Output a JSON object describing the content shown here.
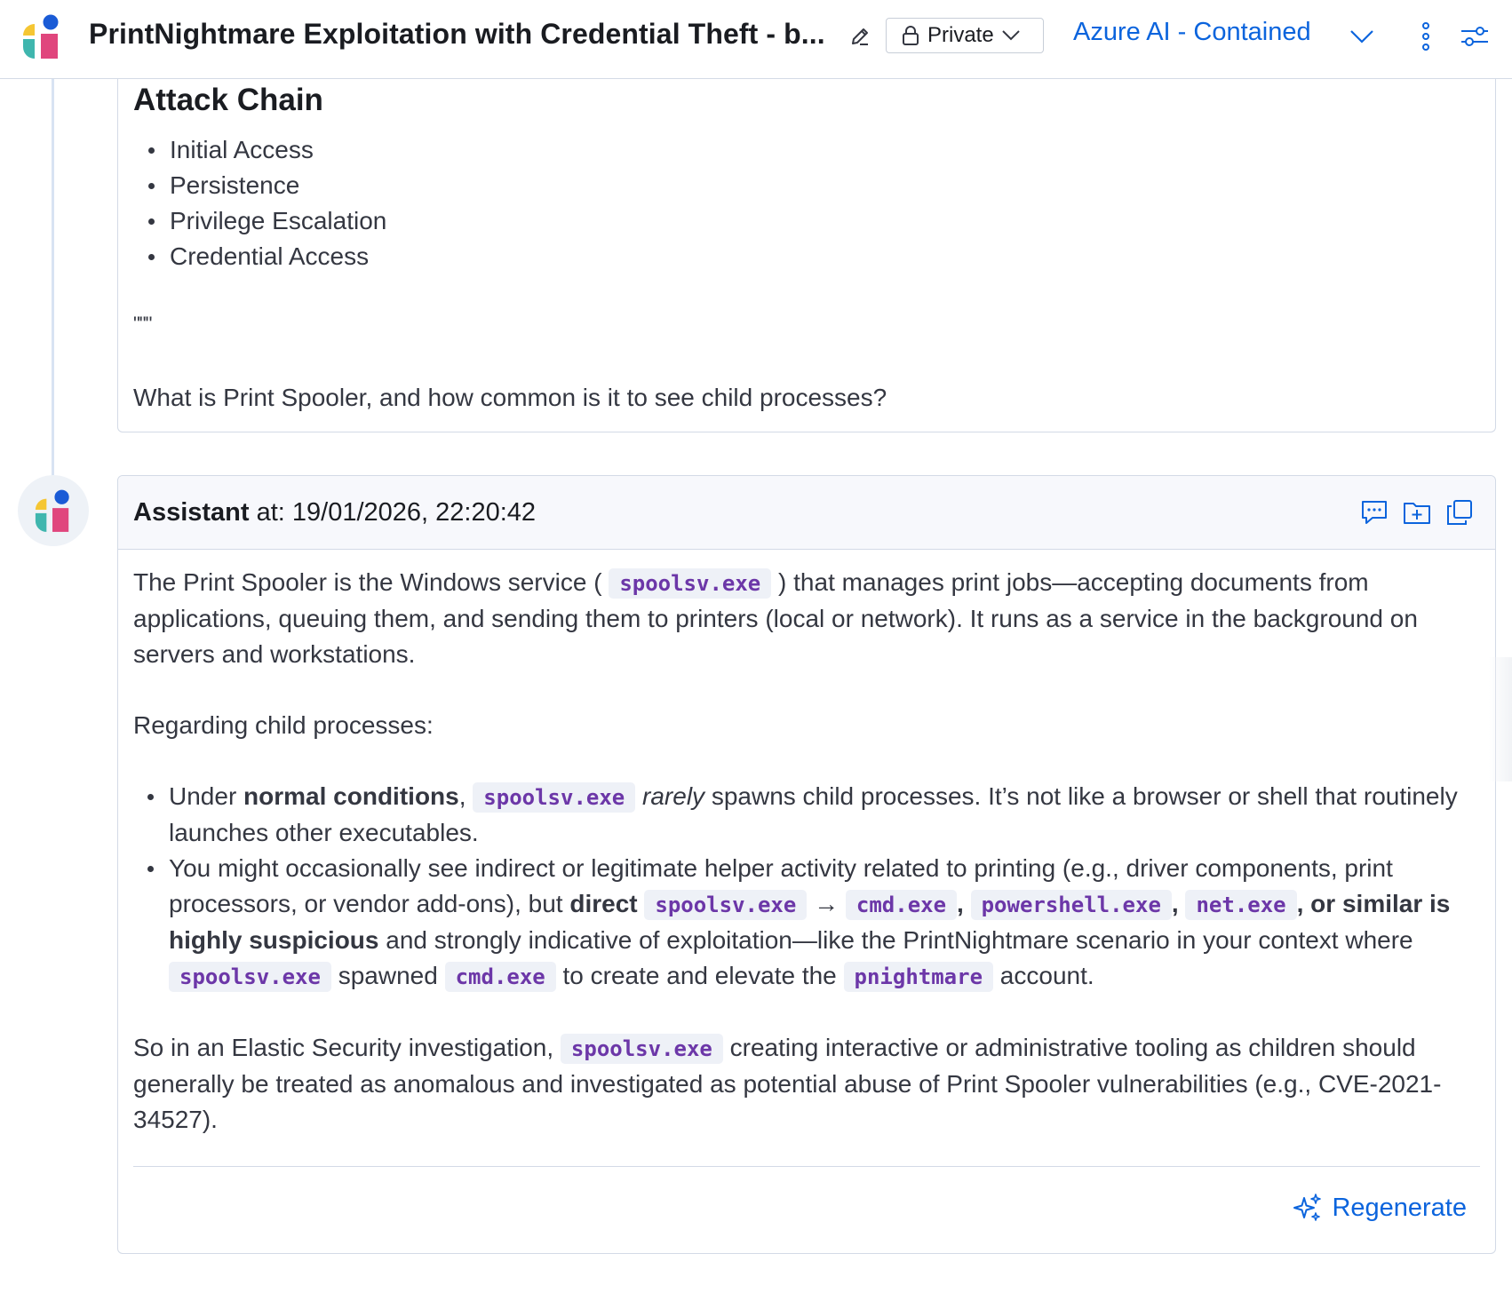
{
  "header": {
    "title": "PrintNightmare Exploitation with Credential Theft - b...",
    "visibility_label": "Private",
    "connector_label": "Azure AI - Contained",
    "icons": [
      "app-logo",
      "pencil-icon",
      "lock-icon",
      "chevron-down-icon",
      "kebab-icon",
      "settings-sliders-icon"
    ]
  },
  "user_message": {
    "heading": "Attack Chain",
    "items": [
      "Initial Access",
      "Persistence",
      "Privilege Escalation",
      "Credential Access"
    ],
    "quotes": "\"\"\"",
    "question": "What is Print Spooler, and how common is it to see child processes?"
  },
  "assistant": {
    "author": "Assistant",
    "at_label": " at: ",
    "timestamp": "19/01/2026, 22:20:42",
    "p1_a": "The Print Spooler is the Windows service ( ",
    "code_spoolsv": "spoolsv.exe",
    "p1_b": " ) that manages print jobs—accepting documents from applications, queuing them, and sending them to printers (local or network). It runs as a service in the background on servers and workstations.",
    "p2": "Regarding child processes:",
    "b1_a": "Under ",
    "b1_bold": "normal conditions",
    "b1_b": ", ",
    "b1_italic": "rarely",
    "b1_c": " spawns child processes. It’s not like a browser or shell that routinely launches other executables.",
    "b2_a": "You might occasionally see indirect or legitimate helper activity related to printing (e.g., driver components, print processors, or vendor add-ons), but ",
    "b2_bold1": "direct",
    "arrow": "→",
    "code_cmd": "cmd.exe",
    "code_powershell": "powershell.exe",
    "code_net": "net.exe",
    "comma": ",",
    "b2_bold2": ", or similar is highly suspicious",
    "b2_b": " and strongly indicative of exploitation—like the PrintNightmare scenario in your context where ",
    "b2_c": " spawned ",
    "b2_d": " to create and elevate the ",
    "code_pnightmare": "pnightmare",
    "b2_e": " account.",
    "p3_a": "So in an Elastic Security investigation, ",
    "p3_b": " creating interactive or administrative tooling as children should generally be treated as anomalous and investigated as potential abuse of Print Spooler vulnerabilities (e.g., CVE-2021-34527).",
    "regenerate_label": "Regenerate",
    "icons": [
      "comment-icon",
      "add-to-folder-icon",
      "copy-icon",
      "sparkles-icon"
    ]
  },
  "colors": {
    "accent": "#0b64dd",
    "code_text": "#6c37a8",
    "code_bg": "#eef1f7",
    "border": "#d3dae6"
  }
}
